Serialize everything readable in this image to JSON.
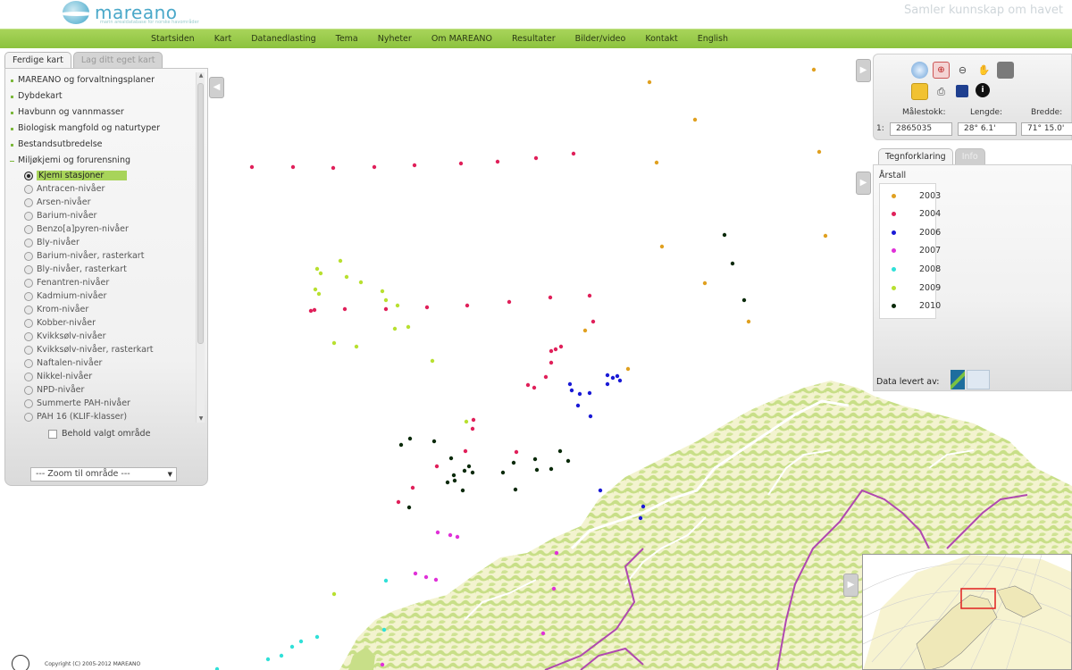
{
  "header": {
    "logo_text": "mareano",
    "logo_sub": "marin arealdatabase for norske havområder",
    "tagline": "Samler kunnskap om havet"
  },
  "nav": [
    "Startsiden",
    "Kart",
    "Datanedlasting",
    "Tema",
    "Nyheter",
    "Om MAREANO",
    "Resultater",
    "Bilder/video",
    "Kontakt",
    "English"
  ],
  "left_panel": {
    "tabs": [
      "Ferdige kart",
      "Lag ditt eget kart"
    ],
    "categories": [
      "MAREANO og forvaltningsplaner",
      "Dybdekart",
      "Havbunn og vannmasser",
      "Biologisk mangfold og naturtyper",
      "Bestandsutbredelse",
      "Miljøkjemi og forurensning"
    ],
    "layers": [
      "Kjemi stasjoner",
      "Antracen-nivåer",
      "Arsen-nivåer",
      "Barium-nivåer",
      "Benzo[a]pyren-nivåer",
      "Bly-nivåer",
      "Barium-nivåer, rasterkart",
      "Bly-nivåer, rasterkart",
      "Fenantren-nivåer",
      "Kadmium-nivåer",
      "Krom-nivåer",
      "Kobber-nivåer",
      "Kvikksølv-nivåer",
      "Kvikksølv-nivåer, rasterkart",
      "Naftalen-nivåer",
      "Nikkel-nivåer",
      "NPD-nivåer",
      "Summerte PAH-nivåer",
      "PAH 16 (KLIF-klasser)"
    ],
    "selected_layer": "Kjemi stasjoner",
    "keep_area_label": "Behold valgt område",
    "zoom_select": "--- Zoom til område ---"
  },
  "tools": {
    "scale_label": "Målestokk:",
    "lon_label": "Lengde:",
    "lat_label": "Bredde:",
    "scale_prefix": "1:",
    "scale_value": "2865035",
    "lon_value": "28° 6.1'",
    "lat_value": "71° 15.0'"
  },
  "legend": {
    "tabs": [
      "Tegnforklaring",
      "Info"
    ],
    "title": "Årstall",
    "items": [
      {
        "year": "2003",
        "color": "#e0a020"
      },
      {
        "year": "2004",
        "color": "#e0205a"
      },
      {
        "year": "2006",
        "color": "#1a1ad6"
      },
      {
        "year": "2007",
        "color": "#e030d8"
      },
      {
        "year": "2008",
        "color": "#30e0d8"
      },
      {
        "year": "2009",
        "color": "#b8e030"
      },
      {
        "year": "2010",
        "color": "#0a2a0a"
      }
    ],
    "data_by": "Data levert av:"
  },
  "footer": {
    "copyright": "Copyright (C) 2005-2012 MAREANO"
  },
  "colors": {
    "nav_green": "#9ccc4c",
    "land": "#f4f4d0",
    "forest": "#c9e08a",
    "border": "#b048b0",
    "water": "#ffffff"
  }
}
